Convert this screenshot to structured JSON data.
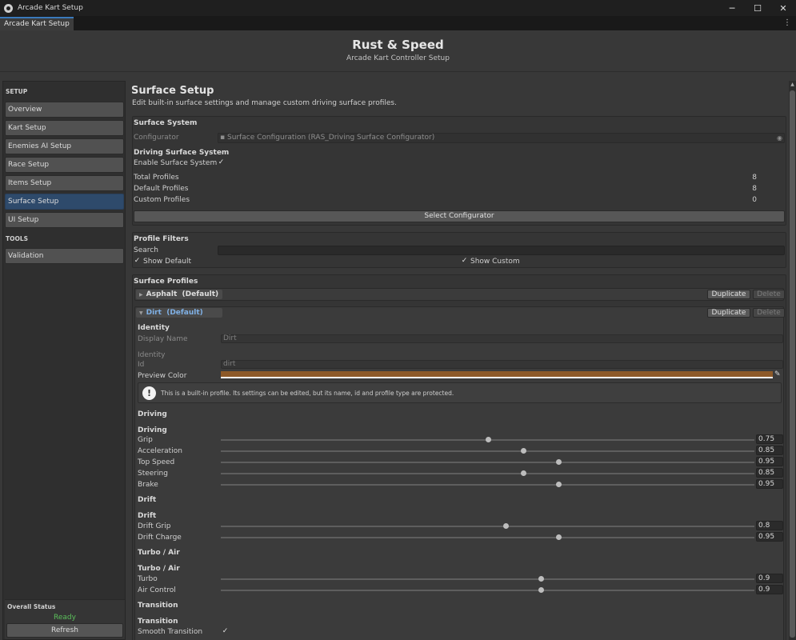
{
  "window": {
    "title": "Arcade Kart Setup",
    "controls": [
      "─",
      "☐",
      "✕"
    ]
  },
  "tab": {
    "label": "Arcade Kart Setup",
    "menu": "⋮"
  },
  "header": {
    "title": "Rust & Speed",
    "subtitle": "Arcade Kart Controller Setup"
  },
  "sidebar": {
    "setup_heading": "SETUP",
    "setup_items": [
      {
        "label": "Overview"
      },
      {
        "label": "Kart Setup"
      },
      {
        "label": "Enemies AI Setup"
      },
      {
        "label": "Race Setup"
      },
      {
        "label": "Items Setup"
      },
      {
        "label": "Surface Setup"
      },
      {
        "label": "UI Setup"
      }
    ],
    "active_item": "Surface Setup",
    "tools_heading": "TOOLS",
    "tools_items": [
      {
        "label": "Validation"
      }
    ],
    "overall_status_title": "Overall Status",
    "overall_status_value": "Ready",
    "refresh_label": "Refresh"
  },
  "page": {
    "title": "Surface Setup",
    "description": "Edit built-in surface settings and manage custom driving surface profiles."
  },
  "surface_system": {
    "title": "Surface System",
    "configurator_label": "Configurator",
    "configurator_value": "Surface Configuration (RAS_Driving Surface Configurator)",
    "driving_title": "Driving Surface System",
    "enable_label": "Enable Surface System",
    "enable_checked": true,
    "total_profiles_label": "Total Profiles",
    "total_profiles": "8",
    "default_profiles_label": "Default Profiles",
    "default_profiles": "8",
    "custom_profiles_label": "Custom Profiles",
    "custom_profiles": "0",
    "select_button": "Select Configurator"
  },
  "filters": {
    "title": "Profile Filters",
    "search_label": "Search",
    "search_value": "",
    "show_default_label": "Show Default",
    "show_default_checked": true,
    "show_custom_label": "Show Custom",
    "show_custom_checked": true
  },
  "profiles": {
    "title": "Surface Profiles",
    "duplicate_label": "Duplicate",
    "delete_label": "Delete",
    "asphalt": {
      "name": "Asphalt",
      "tag": "(Default)",
      "expanded": false
    },
    "dirt": {
      "name": "Dirt",
      "tag": "(Default)",
      "expanded": true,
      "identity_heading": "Identity",
      "display_name_label": "Display Name",
      "display_name_value": "Dirt",
      "identity_sub": "Identity",
      "id_label": "Id",
      "id_value": "dirt",
      "preview_color_label": "Preview Color",
      "preview_color": "#8d5928",
      "help_text": "This is a built-in profile. Its settings can be edited, but its name, id and profile type are protected.",
      "driving_heading": "Driving",
      "driving_sub": "Driving",
      "grip_label": "Grip",
      "grip": "0.75",
      "acceleration_label": "Acceleration",
      "acceleration": "0.85",
      "top_speed_label": "Top Speed",
      "top_speed": "0.95",
      "steering_label": "Steering",
      "steering": "0.85",
      "brake_label": "Brake",
      "brake": "0.95",
      "drift_heading": "Drift",
      "drift_sub": "Drift",
      "drift_grip_label": "Drift Grip",
      "drift_grip": "0.8",
      "drift_charge_label": "Drift Charge",
      "drift_charge": "0.95",
      "turbo_heading": "Turbo / Air",
      "turbo_sub": "Turbo / Air",
      "turbo_label": "Turbo",
      "turbo": "0.9",
      "air_control_label": "Air Control",
      "air_control": "0.9",
      "transition_heading": "Transition",
      "transition_sub": "Transition",
      "smooth_transition_label": "Smooth Transition",
      "smooth_transition_checked": true
    }
  }
}
